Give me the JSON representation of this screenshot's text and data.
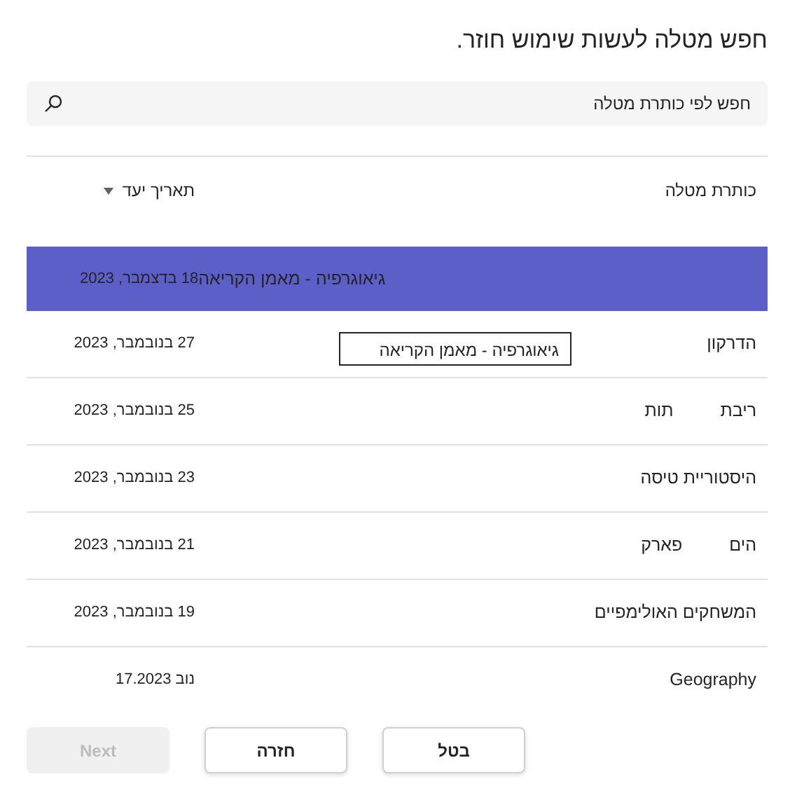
{
  "dialog": {
    "title": "חפש מטלה לעשות שימוש חוזר."
  },
  "search": {
    "placeholder": "חפש לפי כותרת מטלה"
  },
  "table": {
    "columns": [
      {
        "label": "כותרת מטלה"
      },
      {
        "label": "תאריך יעד",
        "sortable": true
      }
    ],
    "rows": [
      {
        "title": "גיאוגרפיה - מאמן הקריאה",
        "due": "18 בדצמבר, 2023",
        "selected": true
      },
      {
        "title": "הדרקון",
        "due": "27 בנובמבר, 2023",
        "selected": false
      },
      {
        "title": "ריבת תות",
        "due": "25 בנובמבר, 2023",
        "selected": false
      },
      {
        "title": "היסטוריית טיסה",
        "due": "23 בנובמבר, 2023",
        "selected": false
      },
      {
        "title": "הים פארק",
        "due": "21 בנובמבר, 2023",
        "selected": false
      },
      {
        "title": "המשחקים האולימפיים",
        "due": "19 בנובמבר, 2023",
        "selected": false
      },
      {
        "title": "Geography",
        "due": "נוב 17.2023",
        "selected": false
      }
    ]
  },
  "tooltip": {
    "text": "גיאוגרפיה - מאמן הקריאה"
  },
  "buttons": [
    {
      "label": "בטל",
      "disabled": false
    },
    {
      "label": "חזרה",
      "disabled": false
    },
    {
      "label": "Next",
      "disabled": true
    }
  ]
}
